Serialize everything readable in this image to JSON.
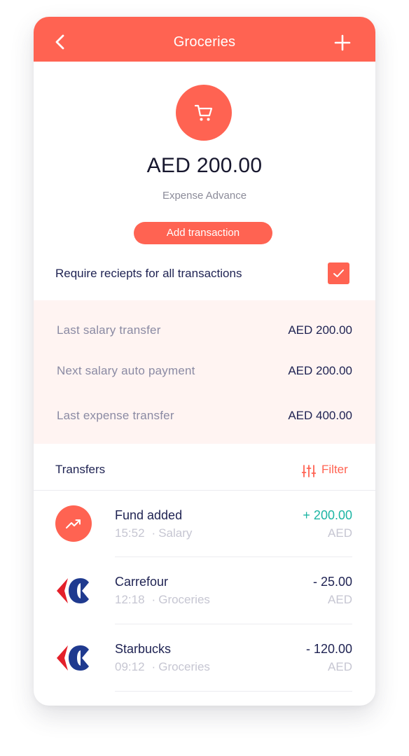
{
  "header": {
    "title": "Groceries",
    "back_icon": "chevron-left-icon",
    "add_icon": "plus-icon",
    "color": "#FF6352"
  },
  "category": {
    "icon": "shopping-cart-icon",
    "amount": "AED 200.00",
    "subtitle": "Expense Advance",
    "add_button": "Add transaction"
  },
  "receipts": {
    "label": "Require reciepts for all transactions",
    "checked": true
  },
  "summary": [
    {
      "label": "Last salary transfer",
      "value": "AED 200.00"
    },
    {
      "label": "Next salary auto payment",
      "value": "AED 200.00"
    },
    {
      "label": "Last expense transfer",
      "value": "AED 400.00"
    }
  ],
  "transfers": {
    "title": "Transfers",
    "filter_label": "Filter",
    "filter_icon": "sliders-icon",
    "items": [
      {
        "name": "Fund added",
        "time": "15:52",
        "category": "Salary",
        "amount": "+ 200.00",
        "currency": "AED",
        "icon": "trending-up-icon",
        "positive": true
      },
      {
        "name": "Carrefour",
        "time": "12:18",
        "category": "Groceries",
        "amount": "- 25.00",
        "currency": "AED",
        "icon": "carrefour-logo-icon",
        "positive": false
      },
      {
        "name": "Starbucks",
        "time": "09:12",
        "category": "Groceries",
        "amount": "- 120.00",
        "currency": "AED",
        "icon": "carrefour-logo-icon",
        "positive": false
      }
    ]
  },
  "colors": {
    "accent": "#FF6352",
    "positive": "#1CB5A3",
    "summary_bg": "#FFF4F2",
    "text_dark": "#1E2252"
  }
}
